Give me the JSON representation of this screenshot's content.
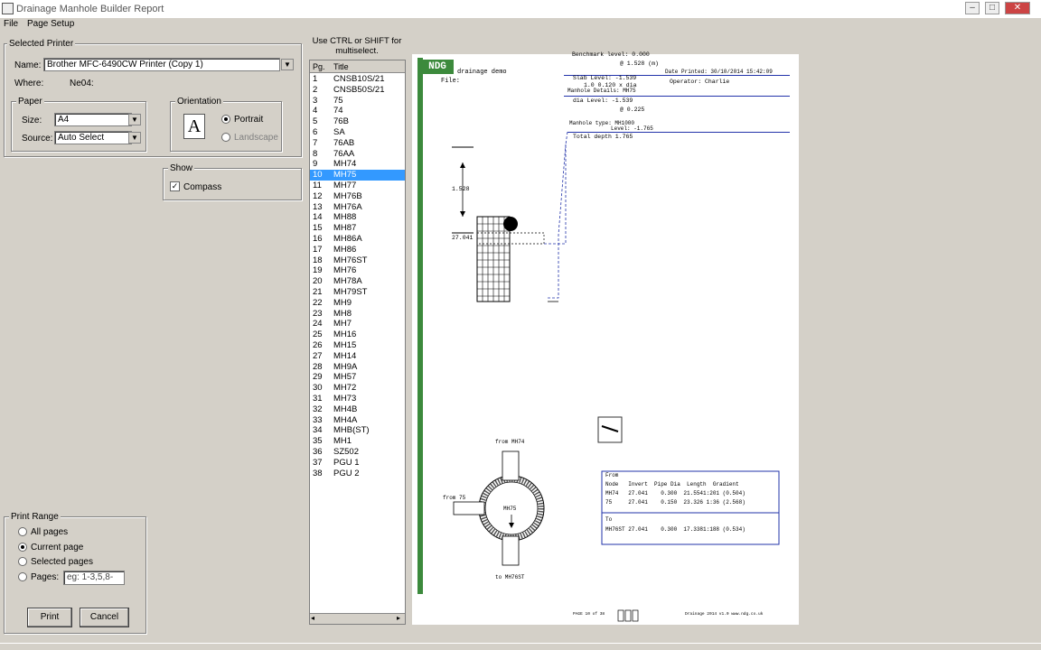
{
  "window": {
    "title": "Drainage Manhole Builder Report",
    "min": "–",
    "max": "□",
    "close": "✕"
  },
  "menu": [
    "File",
    "Page Setup"
  ],
  "printer": {
    "group_label": "Selected Printer",
    "name_label": "Name:",
    "name_value": "Brother MFC-6490CW Printer (Copy 1)",
    "where_label": "Where:",
    "where_value": "Ne04:"
  },
  "paper": {
    "group_label": "Paper",
    "size_label": "Size:",
    "size_value": "A4",
    "source_label": "Source:",
    "source_value": "Auto Select"
  },
  "orientation": {
    "group_label": "Orientation",
    "icon_letter": "A",
    "portrait": "Portrait",
    "landscape": "Landscape"
  },
  "show": {
    "group_label": "Show",
    "compass": "Compass"
  },
  "list": {
    "hint": "Use CTRL or SHIFT for multiselect.",
    "col_pg": "Pg.",
    "col_title": "Title",
    "selected_index": 9,
    "items": [
      [
        "1",
        "CNSB10S/21"
      ],
      [
        "2",
        "CNSB50S/21"
      ],
      [
        "3",
        "75"
      ],
      [
        "4",
        "74"
      ],
      [
        "5",
        "76B"
      ],
      [
        "6",
        "SA"
      ],
      [
        "7",
        "76AB"
      ],
      [
        "8",
        "76AA"
      ],
      [
        "9",
        "MH74"
      ],
      [
        "10",
        "MH75"
      ],
      [
        "11",
        "MH77"
      ],
      [
        "12",
        "MH76B"
      ],
      [
        "13",
        "MH76A"
      ],
      [
        "14",
        "MH88"
      ],
      [
        "15",
        "MH87"
      ],
      [
        "16",
        "MH86A"
      ],
      [
        "17",
        "MH86"
      ],
      [
        "18",
        "MH76ST"
      ],
      [
        "19",
        "MH76"
      ],
      [
        "20",
        "MH78A"
      ],
      [
        "21",
        "MH79ST"
      ],
      [
        "22",
        "MH9"
      ],
      [
        "23",
        "MH8"
      ],
      [
        "24",
        "MH7"
      ],
      [
        "25",
        "MH16"
      ],
      [
        "26",
        "MH15"
      ],
      [
        "27",
        "MH14"
      ],
      [
        "28",
        "MH9A"
      ],
      [
        "29",
        "MH57"
      ],
      [
        "30",
        "MH72"
      ],
      [
        "31",
        "MH73"
      ],
      [
        "32",
        "MH4B"
      ],
      [
        "33",
        "MH4A"
      ],
      [
        "34",
        "MHB(ST)"
      ],
      [
        "35",
        "MH1"
      ],
      [
        "36",
        "SZ502"
      ],
      [
        "37",
        "PGU 1"
      ],
      [
        "38",
        "PGU 2"
      ]
    ]
  },
  "range": {
    "group_label": "Print Range",
    "all": "All pages",
    "current": "Current page",
    "selected": "Selected pages",
    "pages": "Pages:",
    "pages_placeholder": "eg: 1-3,5,8-"
  },
  "buttons": {
    "print": "Print",
    "cancel": "Cancel"
  },
  "preview": {
    "logo": "NDG",
    "project": "drainage demo",
    "file_label": "File:",
    "benchmark": "Benchmark level: 0.000",
    "benchmark2": "@ 1.528 (m)",
    "date_printed": "Date Printed: 30/10/2014 15:42:09",
    "operator": "Operator: Charlie",
    "slab": "Slab    Level: -1.539",
    "manhole_details": "Manhole Details: MH75",
    "size": "1.0  0.120 x  dia",
    "dia": "dia     Level: -1.539",
    "dia2": "@  0.225",
    "manhole_type": "Manhole type: MH1000",
    "type_level": "Level: -1.765",
    "total_depth": "Total depth    1.765",
    "depth_dim": "1.528",
    "invert_dim": "27.041",
    "from_top": "from MH74",
    "from_left": "from 75",
    "centre": "MH75",
    "to_bottom": "to MH76ST",
    "table_from": "From",
    "table_head": "Node   Invert  Pipe Dia  Length  Gradient",
    "table_r1": "MH74   27.041    0.300  21.5541:201 (0.504)",
    "table_r2": "75     27.041    0.150  23.326 1:36 (2.568)",
    "table_to": "To",
    "table_r3": "MH76ST 27.041    0.300  17.3381:188 (0.534)",
    "footer_left": "PAGE 10 of 38",
    "footer_right": "Drainage 2014 v1.0  www.ndg.co.uk"
  }
}
